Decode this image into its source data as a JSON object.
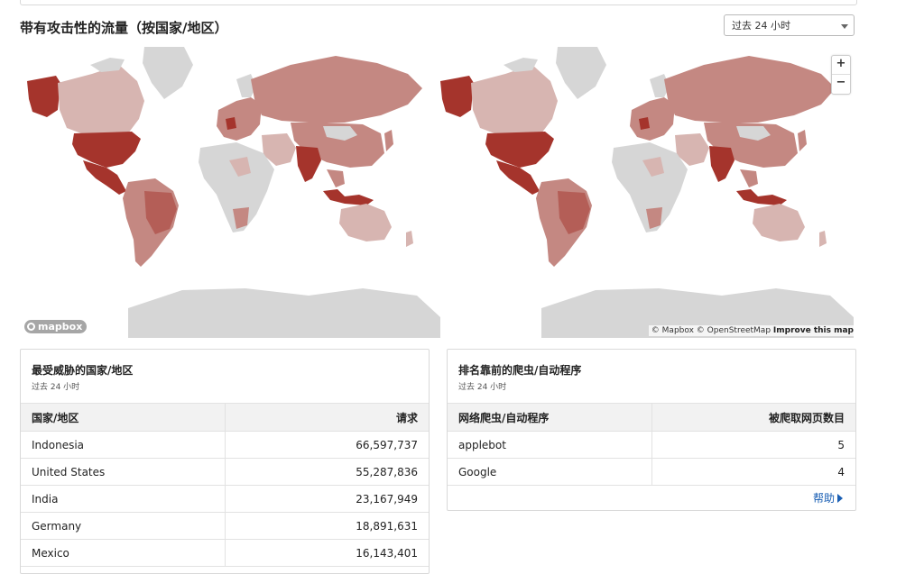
{
  "page": {
    "title": "带有攻击性的流量（按国家/地区）",
    "time_range": {
      "selected": "过去 24 小时"
    }
  },
  "map": {
    "legend": {
      "min": "0",
      "max": "66597737"
    },
    "logo": "mapbox",
    "zoom_in": "+",
    "zoom_out": "−",
    "attribution": {
      "mapbox": "© Mapbox",
      "osm": "© OpenStreetMap",
      "improve": "Improve this map"
    },
    "colors": {
      "high": "#a5342c",
      "mid": "#c48882",
      "low": "#d7b5b1",
      "none": "#d6d6d6"
    }
  },
  "top_countries": {
    "title": "最受威胁的国家/地区",
    "subtitle": "过去 24 小时",
    "headers": {
      "country": "国家/地区",
      "requests": "请求"
    },
    "rows": [
      {
        "name": "Indonesia",
        "value": "66,597,737"
      },
      {
        "name": "United States",
        "value": "55,287,836"
      },
      {
        "name": "India",
        "value": "23,167,949"
      },
      {
        "name": "Germany",
        "value": "18,891,631"
      },
      {
        "name": "Mexico",
        "value": "16,143,401"
      }
    ]
  },
  "top_bots": {
    "title": "排名靠前的爬虫/自动程序",
    "subtitle": "过去 24 小时",
    "headers": {
      "bot": "网络爬虫/自动程序",
      "pages": "被爬取网页数目"
    },
    "rows": [
      {
        "name": "applebot",
        "value": "5"
      },
      {
        "name": "Google",
        "value": "4"
      }
    ],
    "help": "帮助"
  }
}
